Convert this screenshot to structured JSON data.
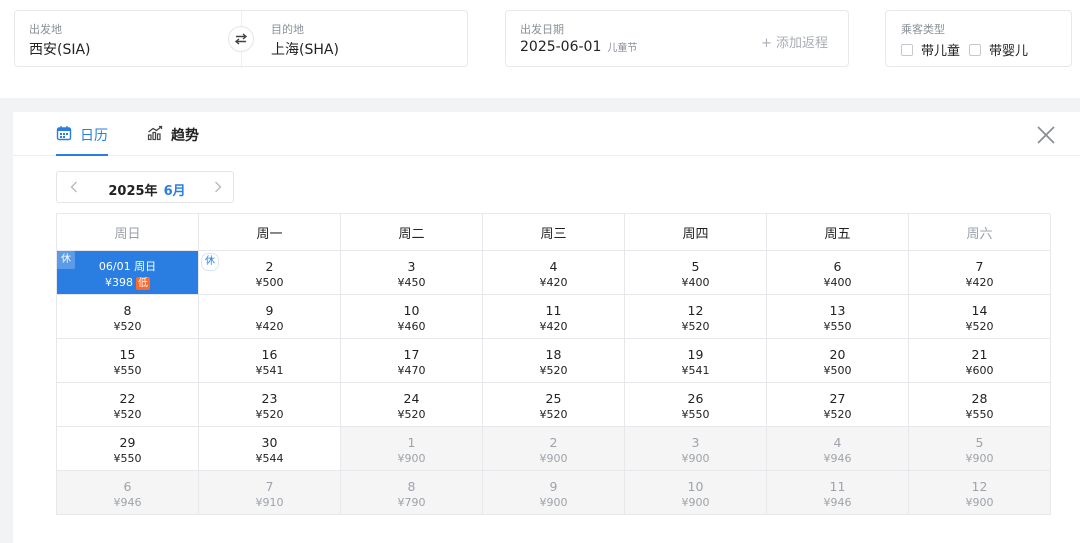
{
  "search": {
    "origin_label": "出发地",
    "origin_value": "西安(SIA)",
    "dest_label": "目的地",
    "dest_value": "上海(SHA)",
    "swap_icon": "swap-arrows-icon",
    "date_label": "出发日期",
    "date_value": "2025-06-01",
    "date_holiday": "儿童节",
    "add_return": "+ 添加返程",
    "pax_label": "乘客类型",
    "with_child": "带儿童",
    "with_infant": "带婴儿"
  },
  "tabs": {
    "calendar": "日历",
    "trend": "趋势"
  },
  "month_nav": {
    "year": "2025年",
    "month": "6月"
  },
  "weekdays": [
    "周日",
    "周一",
    "周二",
    "周三",
    "周四",
    "周五",
    "周六"
  ],
  "rest_badge": "休",
  "low_tag": "低",
  "selected_label": "06/01 周日",
  "days": [
    {
      "d": "1",
      "p": "¥398",
      "state": "selected"
    },
    {
      "d": "2",
      "p": "¥500"
    },
    {
      "d": "3",
      "p": "¥450"
    },
    {
      "d": "4",
      "p": "¥420"
    },
    {
      "d": "5",
      "p": "¥400"
    },
    {
      "d": "6",
      "p": "¥400"
    },
    {
      "d": "7",
      "p": "¥420"
    },
    {
      "d": "8",
      "p": "¥520"
    },
    {
      "d": "9",
      "p": "¥420"
    },
    {
      "d": "10",
      "p": "¥460"
    },
    {
      "d": "11",
      "p": "¥420"
    },
    {
      "d": "12",
      "p": "¥520"
    },
    {
      "d": "13",
      "p": "¥550"
    },
    {
      "d": "14",
      "p": "¥520"
    },
    {
      "d": "15",
      "p": "¥550"
    },
    {
      "d": "16",
      "p": "¥541"
    },
    {
      "d": "17",
      "p": "¥470"
    },
    {
      "d": "18",
      "p": "¥520"
    },
    {
      "d": "19",
      "p": "¥541"
    },
    {
      "d": "20",
      "p": "¥500"
    },
    {
      "d": "21",
      "p": "¥600"
    },
    {
      "d": "22",
      "p": "¥520"
    },
    {
      "d": "23",
      "p": "¥520"
    },
    {
      "d": "24",
      "p": "¥520"
    },
    {
      "d": "25",
      "p": "¥520"
    },
    {
      "d": "26",
      "p": "¥550"
    },
    {
      "d": "27",
      "p": "¥520"
    },
    {
      "d": "28",
      "p": "¥550"
    },
    {
      "d": "29",
      "p": "¥550"
    },
    {
      "d": "30",
      "p": "¥544"
    },
    {
      "d": "1",
      "p": "¥900",
      "state": "off"
    },
    {
      "d": "2",
      "p": "¥900",
      "state": "off"
    },
    {
      "d": "3",
      "p": "¥900",
      "state": "off"
    },
    {
      "d": "4",
      "p": "¥946",
      "state": "off"
    },
    {
      "d": "5",
      "p": "¥900",
      "state": "off"
    },
    {
      "d": "6",
      "p": "¥946",
      "state": "off"
    },
    {
      "d": "7",
      "p": "¥910",
      "state": "off"
    },
    {
      "d": "8",
      "p": "¥790",
      "state": "off"
    },
    {
      "d": "9",
      "p": "¥900",
      "state": "off"
    },
    {
      "d": "10",
      "p": "¥900",
      "state": "off"
    },
    {
      "d": "11",
      "p": "¥946",
      "state": "off"
    },
    {
      "d": "12",
      "p": "¥900",
      "state": "off"
    }
  ],
  "colors": {
    "accent": "#2a7de1",
    "low_tag": "#ff6a2b"
  }
}
